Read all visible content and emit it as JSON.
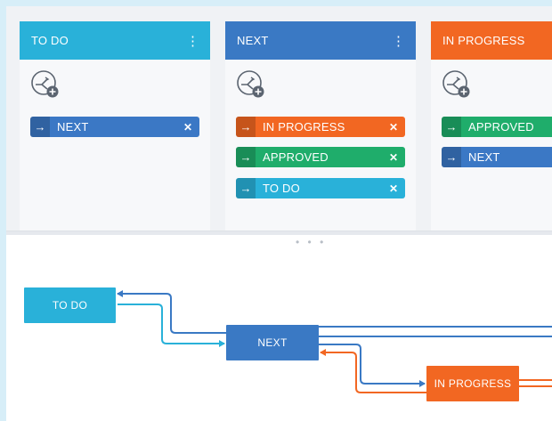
{
  "colors": {
    "todo": "#29b1d9",
    "next": "#3a79c4",
    "in_progress": "#f26722",
    "approved": "#1fad6b",
    "next_chip": "#3b78c5"
  },
  "board": {
    "columns": [
      {
        "title": "TO DO",
        "menu_icon": "⋮",
        "add_icon": "add-transition-icon",
        "transitions": [
          {
            "label": "NEXT",
            "arrow": "→",
            "remove": "✕"
          }
        ]
      },
      {
        "title": "NEXT",
        "menu_icon": "⋮",
        "add_icon": "add-transition-icon",
        "transitions": [
          {
            "label": "IN PROGRESS",
            "arrow": "→",
            "remove": "✕"
          },
          {
            "label": "APPROVED",
            "arrow": "→",
            "remove": "✕"
          },
          {
            "label": "TO DO",
            "arrow": "→",
            "remove": "✕"
          }
        ]
      },
      {
        "title": "IN PROGRESS",
        "add_icon": "add-transition-icon",
        "transitions": [
          {
            "label": "APPROVED",
            "arrow": "→"
          },
          {
            "label": "NEXT",
            "arrow": "→"
          }
        ]
      }
    ]
  },
  "divider": {
    "handle": "• • •"
  },
  "diagram": {
    "nodes": {
      "todo": "TO DO",
      "next": "NEXT",
      "in_progress": "IN PROGRESS"
    }
  }
}
